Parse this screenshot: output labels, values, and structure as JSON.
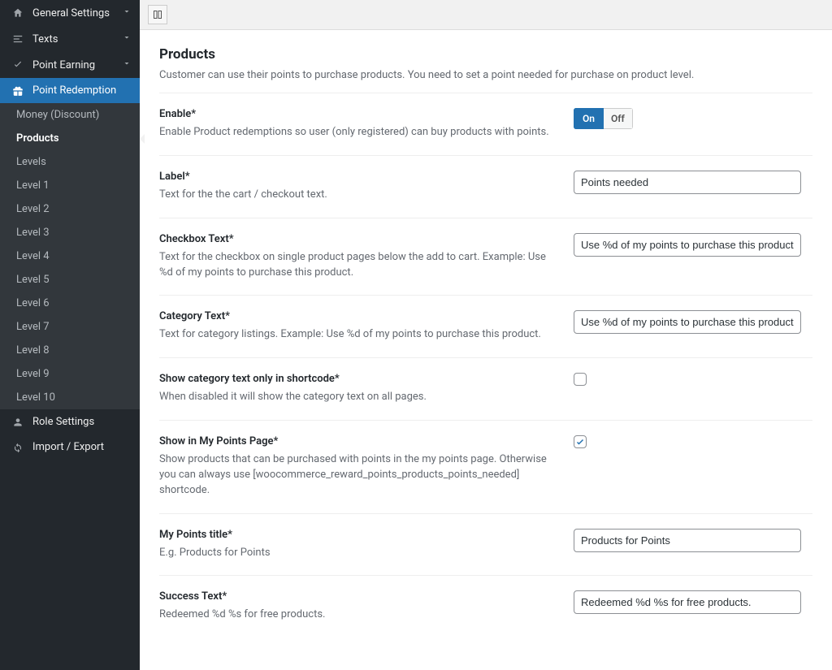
{
  "sidebar": {
    "top": [
      {
        "label": "General Settings",
        "icon": "home"
      },
      {
        "label": "Texts",
        "icon": "align"
      },
      {
        "label": "Point Earning",
        "icon": "check"
      }
    ],
    "active_parent": {
      "label": "Point Redemption",
      "icon": "gift"
    },
    "sub": [
      {
        "label": "Money (Discount)"
      },
      {
        "label": "Products",
        "current": true
      },
      {
        "label": "Levels"
      },
      {
        "label": "Level 1"
      },
      {
        "label": "Level 2"
      },
      {
        "label": "Level 3"
      },
      {
        "label": "Level 4"
      },
      {
        "label": "Level 5"
      },
      {
        "label": "Level 6"
      },
      {
        "label": "Level 7"
      },
      {
        "label": "Level 8"
      },
      {
        "label": "Level 9"
      },
      {
        "label": "Level 10"
      }
    ],
    "bottom": [
      {
        "label": "Role Settings",
        "icon": "user"
      },
      {
        "label": "Import / Export",
        "icon": "refresh"
      }
    ]
  },
  "page": {
    "title": "Products",
    "desc": "Customer can use their points to purchase products. You need to set a point needed for purchase on product level."
  },
  "toggle": {
    "on": "On",
    "off": "Off"
  },
  "fields": {
    "enable": {
      "label": "Enable*",
      "help": "Enable Product redemptions so user (only registered) can buy products with points."
    },
    "label": {
      "label": "Label*",
      "help": "Text for the the cart / checkout text.",
      "value": "Points needed"
    },
    "checkbox_text": {
      "label": "Checkbox Text*",
      "help": "Text for the checkbox on single product pages below the add to cart. Example: Use %d of my points to purchase this product.",
      "value": "Use %d of my points to purchase this product."
    },
    "category_text": {
      "label": "Category Text*",
      "help": "Text for category listings. Example: Use %d of my points to purchase this product.",
      "value": "Use %d of my points to purchase this product."
    },
    "shortcode_only": {
      "label": "Show category text only in shortcode*",
      "help": "When disabled it will show the category text on all pages."
    },
    "show_my_points": {
      "label": "Show in My Points Page*",
      "help": "Show products that can be purchased with points in the my points page. Otherwise you can always use [woocommerce_reward_points_products_points_needed] shortcode."
    },
    "my_points_title": {
      "label": "My Points title*",
      "help": "E.g. Products for Points",
      "value": "Products for Points"
    },
    "success_text": {
      "label": "Success Text*",
      "help": "Redeemed %d %s for free products.",
      "value": "Redeemed %d %s for free products."
    }
  }
}
